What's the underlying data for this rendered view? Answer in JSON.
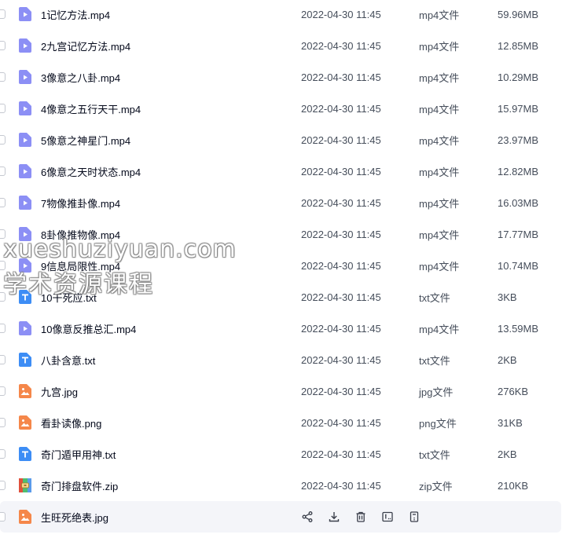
{
  "files": [
    {
      "name": "1记忆方法.mp4",
      "time": "2022-04-30 11:45",
      "type": "mp4文件",
      "size": "59.96MB",
      "icon": "video-icon"
    },
    {
      "name": "2九宫记忆方法.mp4",
      "time": "2022-04-30 11:45",
      "type": "mp4文件",
      "size": "12.85MB",
      "icon": "video-icon"
    },
    {
      "name": "3像意之八卦.mp4",
      "time": "2022-04-30 11:45",
      "type": "mp4文件",
      "size": "10.29MB",
      "icon": "video-icon"
    },
    {
      "name": "4像意之五行天干.mp4",
      "time": "2022-04-30 11:45",
      "type": "mp4文件",
      "size": "15.97MB",
      "icon": "video-icon"
    },
    {
      "name": "5像意之神星门.mp4",
      "time": "2022-04-30 11:45",
      "type": "mp4文件",
      "size": "23.97MB",
      "icon": "video-icon"
    },
    {
      "name": "6像意之天时状态.mp4",
      "time": "2022-04-30 11:45",
      "type": "mp4文件",
      "size": "12.82MB",
      "icon": "video-icon"
    },
    {
      "name": "7物像推卦像.mp4",
      "time": "2022-04-30 11:45",
      "type": "mp4文件",
      "size": "16.03MB",
      "icon": "video-icon"
    },
    {
      "name": "8卦像推物像.mp4",
      "time": "2022-04-30 11:45",
      "type": "mp4文件",
      "size": "17.77MB",
      "icon": "video-icon"
    },
    {
      "name": "9信息局限性.mp4",
      "time": "2022-04-30 11:45",
      "type": "mp4文件",
      "size": "10.74MB",
      "icon": "video-icon"
    },
    {
      "name": "10干死应.txt",
      "time": "2022-04-30 11:45",
      "type": "txt文件",
      "size": "3KB",
      "icon": "text-icon"
    },
    {
      "name": "10像意反推总汇.mp4",
      "time": "2022-04-30 11:45",
      "type": "mp4文件",
      "size": "13.59MB",
      "icon": "video-icon"
    },
    {
      "name": "八卦含意.txt",
      "time": "2022-04-30 11:45",
      "type": "txt文件",
      "size": "2KB",
      "icon": "text-icon"
    },
    {
      "name": "九宫.jpg",
      "time": "2022-04-30 11:45",
      "type": "jpg文件",
      "size": "276KB",
      "icon": "image-icon"
    },
    {
      "name": "看卦读像.png",
      "time": "2022-04-30 11:45",
      "type": "png文件",
      "size": "31KB",
      "icon": "image-icon"
    },
    {
      "name": "奇门遁甲用神.txt",
      "time": "2022-04-30 11:45",
      "type": "txt文件",
      "size": "2KB",
      "icon": "text-icon"
    },
    {
      "name": "奇门排盘软件.zip",
      "time": "2022-04-30 11:45",
      "type": "zip文件",
      "size": "210KB",
      "icon": "archive-icon"
    }
  ],
  "hovered_file": {
    "name": "生旺死绝表.jpg",
    "icon": "image-icon"
  },
  "hover_actions": [
    "share-icon",
    "download-icon",
    "delete-icon",
    "rename-icon",
    "more-icon"
  ],
  "watermark": {
    "line1": "xueshuziyuan.com",
    "line2": "学术资源课程"
  },
  "colors": {
    "video": "#8c8ff5",
    "text": "#3d8df5",
    "image": "#f5874a",
    "archive": "#f2b83c",
    "hover_bg": "#f4f5f9"
  }
}
